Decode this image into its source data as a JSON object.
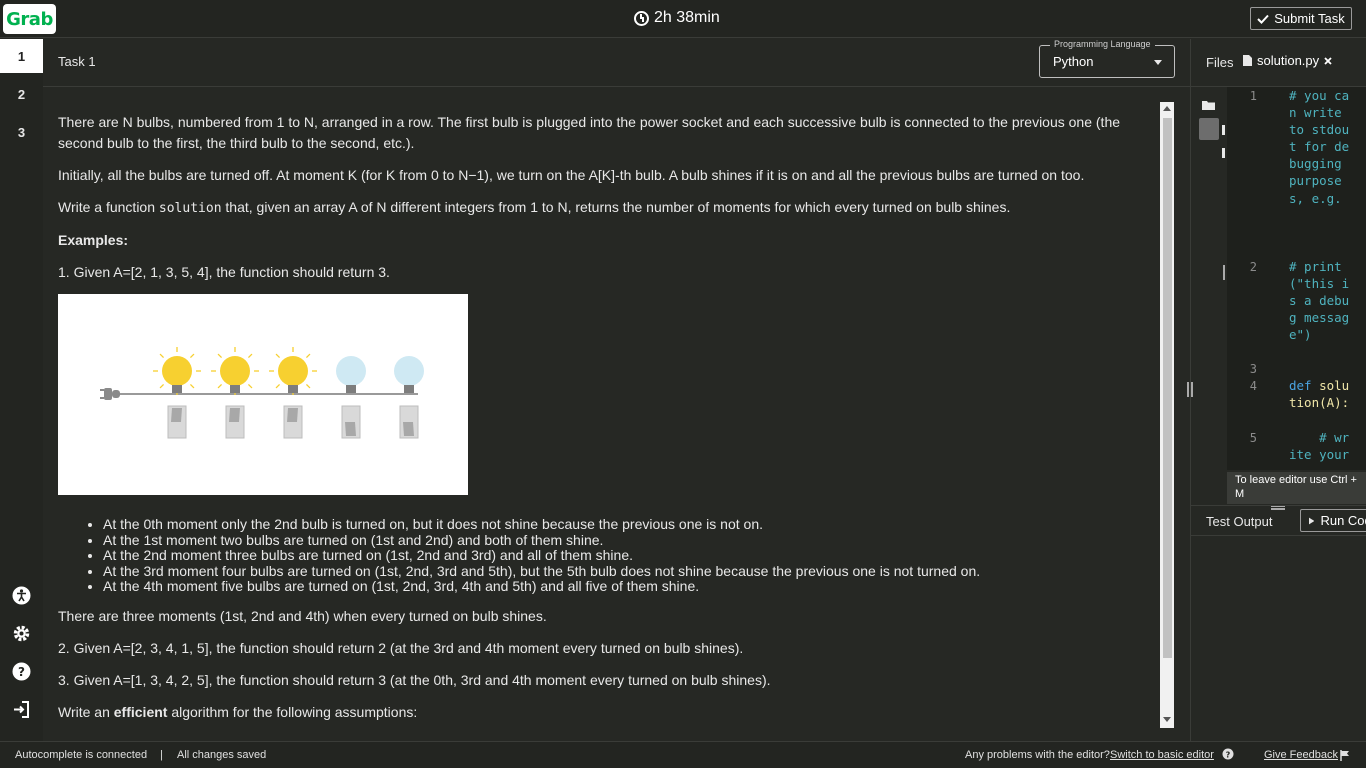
{
  "header": {
    "logo_text": "Grab",
    "timer": "2h 38min",
    "submit_label": "Submit Task"
  },
  "tasks": [
    "1",
    "2",
    "3"
  ],
  "task_header": {
    "title": "Task 1",
    "language_legend": "Programming Language",
    "language_value": "Python"
  },
  "description": {
    "p1": "There are N bulbs, numbered from 1 to N, arranged in a row. The first bulb is plugged into the power socket and each successive bulb is connected to the previous one (the second bulb to the first, the third bulb to the second, etc.).",
    "p2": "Initially, all the bulbs are turned off. At moment K (for K from 0 to N−1), we turn on the A[K]-th bulb. A bulb shines if it is on and all the previous bulbs are turned on too.",
    "p3_pre": "Write a function ",
    "p3_code": "solution",
    "p3_post": " that, given an array A of N different integers from 1 to N, returns the number of moments for which every turned on bulb shines.",
    "examples_heading": "Examples:",
    "ex1": "1. Given A=[2, 1, 3, 5, 4], the function should return 3.",
    "bullets": [
      "At the 0th moment only the 2nd bulb is turned on, but it does not shine because the previous one is not on.",
      "At the 1st moment two bulbs are turned on (1st and 2nd) and both of them shine.",
      "At the 2nd moment three bulbs are turned on (1st, 2nd and 3rd) and all of them shine.",
      "At the 3rd moment four bulbs are turned on (1st, 2nd, 3rd and 5th), but the 5th bulb does not shine because the previous one is not turned on.",
      "At the 4th moment five bulbs are turned on (1st, 2nd, 3rd, 4th and 5th) and all five of them shine."
    ],
    "p4": "There are three moments (1st, 2nd and 4th) when every turned on bulb shines.",
    "ex2": "2. Given A=[2, 3, 4, 1, 5], the function should return 2 (at the 3rd and 4th moment every turned on bulb shines).",
    "ex3": "3. Given A=[1, 3, 4, 2, 5], the function should return 3 (at the 0th, 3rd and 4th moment every turned on bulb shines).",
    "p5_pre": "Write an ",
    "p5_bold": "efficient",
    "p5_post": " algorithm for the following assumptions:"
  },
  "editor": {
    "files_label": "Files",
    "file_name": "solution.py",
    "line_numbers": [
      "1",
      "2",
      "3",
      "4",
      "5"
    ],
    "code_lines": [
      "# you can write to stdout for debugging purposes, e.g.",
      "# print(\"this is a debug message\")",
      "",
      "def solution(A):",
      "    # write your"
    ],
    "hint": "To leave editor use Ctrl + M",
    "test_output_label": "Test Output",
    "run_label": "Run Code"
  },
  "status": {
    "autocomplete": "Autocomplete is connected",
    "separator": "|",
    "saved": "All changes saved",
    "problem_text": "Any problems with the editor?",
    "switch_link": "Switch to basic editor",
    "feedback_link": "Give Feedback"
  },
  "colors": {
    "brand_green": "#00b14f",
    "background": "#262824",
    "bulb_on": "#f7d030",
    "bulb_off": "#cfe9f3",
    "code_comment": "#4fb3bf",
    "code_keyword": "#4aa3e0",
    "code_default": "#f0e6a8"
  },
  "icons": {
    "clock": "clock-icon",
    "check": "check-icon",
    "accessibility": "accessibility-icon",
    "settings": "gear-icon",
    "help": "help-icon",
    "exit": "exit-icon",
    "file": "file-icon",
    "close": "close-icon",
    "folder": "folder-icon",
    "play": "play-icon",
    "flag": "flag-icon"
  }
}
